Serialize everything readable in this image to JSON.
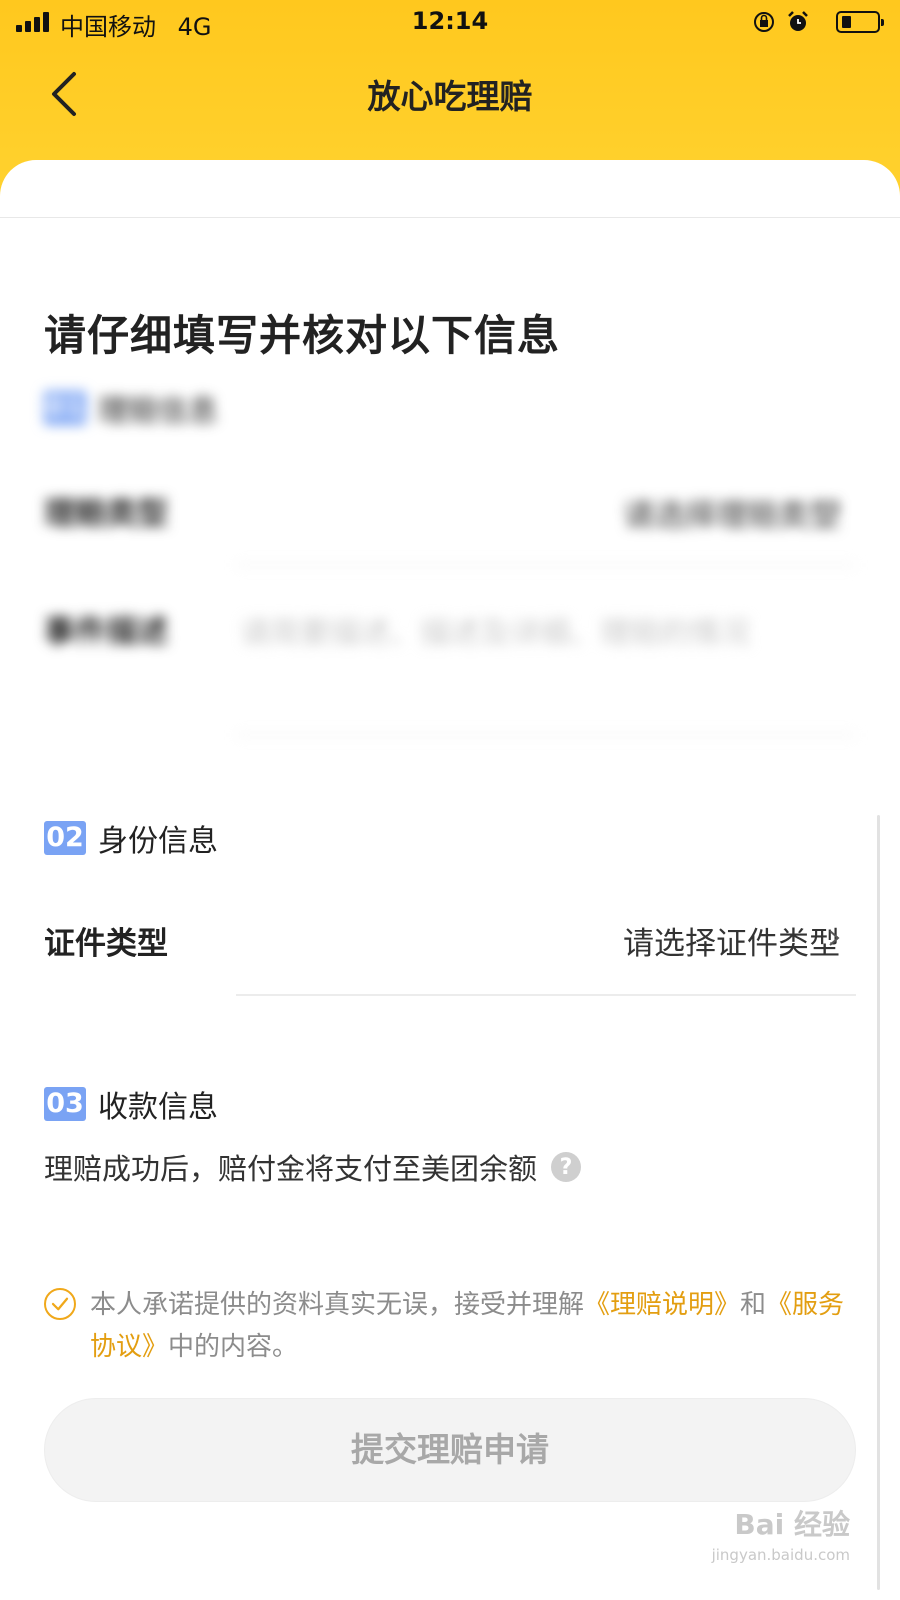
{
  "status_bar": {
    "carrier": "中国移动",
    "network": "4G",
    "time": "12:14"
  },
  "nav": {
    "title": "放心吃理赔"
  },
  "heading": "请仔细填写并核对以下信息",
  "section1": {
    "badge": "01",
    "title": "理赔信息",
    "rows": [
      {
        "label": "理赔类型",
        "value": "请选择理赔类型"
      },
      {
        "label": "事件描述",
        "placeholder": "请简要描述、描述及详细、理赔的情况"
      }
    ]
  },
  "section2": {
    "badge": "02",
    "title": "身份信息",
    "row": {
      "label": "证件类型",
      "value": "请选择证件类型"
    }
  },
  "section3": {
    "badge": "03",
    "title": "收款信息",
    "note": "理赔成功后，赔付金将支付至美团余额"
  },
  "agreement": {
    "text_before": "本人承诺提供的资料真实无误，接受并理解",
    "link1": "《理赔说明》",
    "text_mid": "和",
    "link2": "《服务协议》",
    "text_after": "中的内容。"
  },
  "submit_label": "提交理赔申请",
  "watermark": {
    "brand": "Bai 经验",
    "url": "jingyan.baidu.com"
  },
  "colors": {
    "header": "#ffc81e",
    "badge": "#7aa3f4",
    "link": "#e39e11",
    "button_bg": "#f3f3f3"
  }
}
